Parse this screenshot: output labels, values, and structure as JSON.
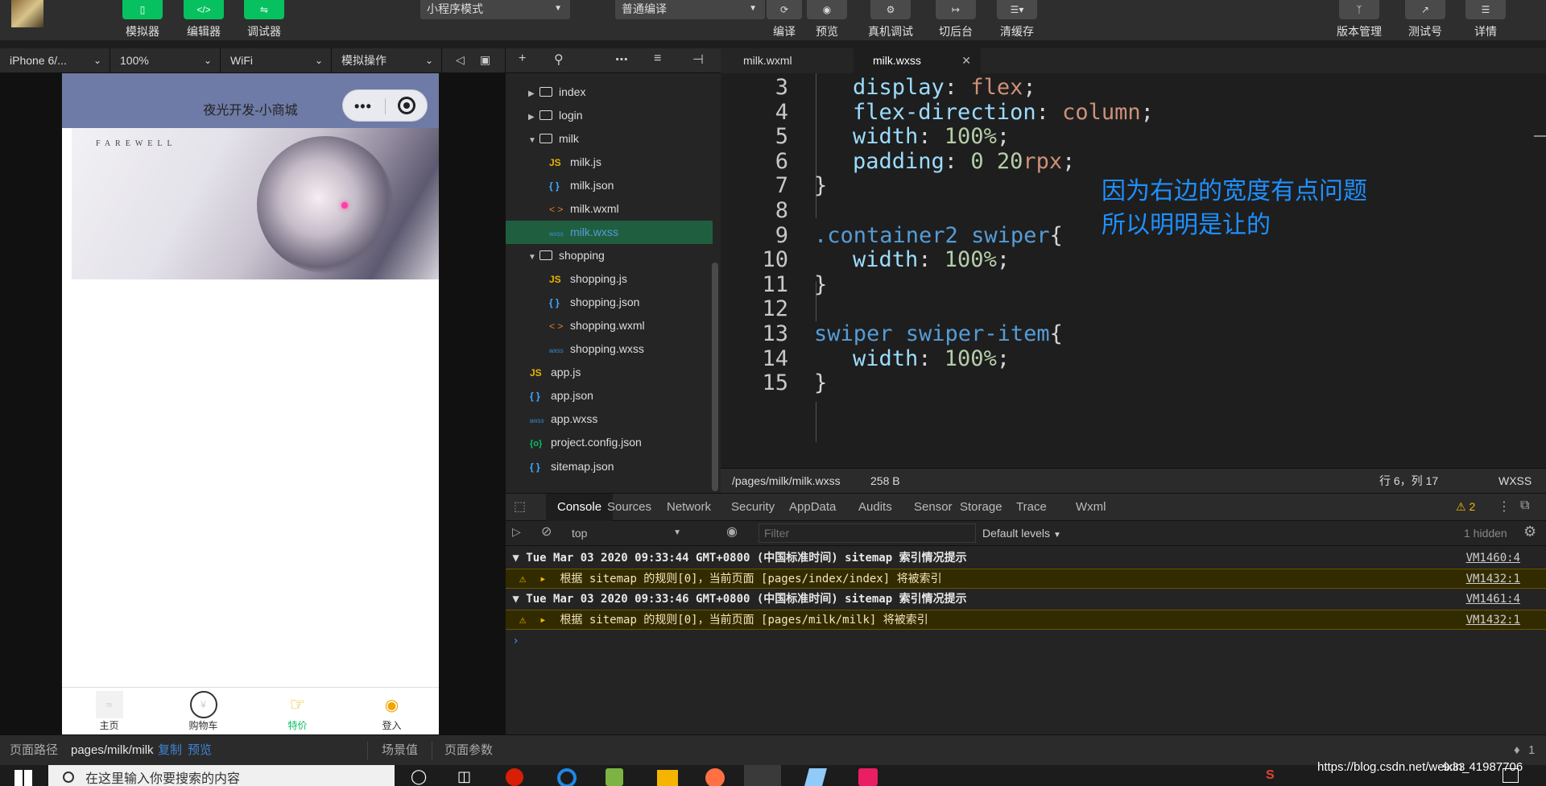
{
  "toolbar": {
    "simulator": "模拟器",
    "editor": "编辑器",
    "debugger": "调试器",
    "mode": "小程序模式",
    "compile_mode": "普通编译",
    "compile": "编译",
    "preview": "预览",
    "real_debug": "真机调试",
    "background": "切后台",
    "clear_cache": "清缓存",
    "version": "版本管理",
    "test_account": "测试号",
    "details": "详情"
  },
  "device_bar": {
    "device": "iPhone 6/...",
    "zoom": "100%",
    "network": "WiFi",
    "operation": "模拟操作"
  },
  "phone": {
    "nav_title": "夜光开发-小商城",
    "banner_text": "FAREWELL",
    "tabs": [
      {
        "label": "主页",
        "icon": "wifi-icon"
      },
      {
        "label": "购物车",
        "icon": "cart-icon"
      },
      {
        "label": "特价",
        "icon": "megaphone-icon"
      },
      {
        "label": "登入",
        "icon": "lightbulb-icon"
      }
    ]
  },
  "explorer": {
    "items": [
      {
        "label": "index",
        "type": "folder"
      },
      {
        "label": "login",
        "type": "folder"
      },
      {
        "label": "milk",
        "type": "folder-open"
      },
      {
        "label": "milk.js",
        "type": "js"
      },
      {
        "label": "milk.json",
        "type": "json"
      },
      {
        "label": "milk.wxml",
        "type": "wxml"
      },
      {
        "label": "milk.wxss",
        "type": "wxss"
      },
      {
        "label": "shopping",
        "type": "folder-open"
      },
      {
        "label": "shopping.js",
        "type": "js"
      },
      {
        "label": "shopping.json",
        "type": "json"
      },
      {
        "label": "shopping.wxml",
        "type": "wxml"
      },
      {
        "label": "shopping.wxss",
        "type": "wxss"
      },
      {
        "label": "app.js",
        "type": "js"
      },
      {
        "label": "app.json",
        "type": "json"
      },
      {
        "label": "app.wxss",
        "type": "wxss"
      },
      {
        "label": "project.config.json",
        "type": "cfg"
      },
      {
        "label": "sitemap.json",
        "type": "json"
      }
    ],
    "icons": {
      "js": "JS",
      "json": "{ }",
      "wxml": "< >",
      "wxss": "wxss",
      "cfg": "{o}"
    }
  },
  "editor": {
    "tabs": [
      "milk.wxml",
      "milk.wxss"
    ],
    "line_numbers": [
      "3",
      "4",
      "5",
      "6",
      "7",
      "8",
      "9",
      "10",
      "11",
      "12",
      "13",
      "14",
      "15"
    ],
    "tokens": {
      "l3": [
        "display",
        ": ",
        "flex",
        ";"
      ],
      "l4": [
        "flex-direction",
        ": ",
        "column",
        ";"
      ],
      "l5": [
        "width",
        ": ",
        "100%",
        ";"
      ],
      "l6": [
        "padding",
        ": ",
        "0 20",
        "rpx",
        ";"
      ],
      "l7": "}",
      "l9": [
        ".container2 swiper",
        "{"
      ],
      "l10": [
        "width",
        ": ",
        "100%",
        ";"
      ],
      "l11": "}",
      "l13": [
        "swiper swiper-item",
        "{"
      ],
      "l14": [
        "width",
        ": ",
        "100%",
        ";"
      ],
      "l15": "}"
    },
    "annotation_line1": "因为右边的宽度有点问题",
    "annotation_line2": "所以明明是让的"
  },
  "editor_status": {
    "path": "/pages/milk/milk.wxss",
    "size": "258 B",
    "position": "行 6，列 17",
    "language": "WXSS"
  },
  "devtools": {
    "tabs": [
      "Console",
      "Sources",
      "Network",
      "Security",
      "AppData",
      "Audits",
      "Sensor",
      "Storage",
      "Trace",
      "Wxml"
    ],
    "warning_count": "2",
    "context": "top",
    "filter_placeholder": "Filter",
    "levels": "Default levels",
    "hidden": "1 hidden",
    "logs": [
      {
        "kind": "group",
        "text": "Tue Mar 03 2020 09:33:44 GMT+0800 (中国标准时间) sitemap 索引情况提示",
        "src": "VM1460:4"
      },
      {
        "kind": "warn",
        "text": "根据 sitemap 的规则[0]，当前页面 [pages/index/index] 将被索引",
        "src": "VM1432:1"
      },
      {
        "kind": "group",
        "text": "Tue Mar 03 2020 09:33:46 GMT+0800 (中国标准时间) sitemap 索引情况提示",
        "src": "VM1461:4"
      },
      {
        "kind": "warn",
        "text": "根据 sitemap 的规则[0]，当前页面 [pages/milk/milk] 将被索引",
        "src": "VM1432:1"
      }
    ]
  },
  "pathbar": {
    "label": "页面路径",
    "path": "pages/milk/milk",
    "copy": "复制",
    "preview": "预览",
    "scene": "场景值",
    "params": "页面参数",
    "notifications": "1"
  },
  "taskbar": {
    "search_placeholder": "在这里输入你要搜索的内容",
    "watermark": "https://blog.csdn.net/weixin_41987706",
    "time": "9:33"
  },
  "colors": {
    "accent": "#07c160",
    "annotation": "#1e90ff",
    "selected_file": "#1f5f40"
  }
}
